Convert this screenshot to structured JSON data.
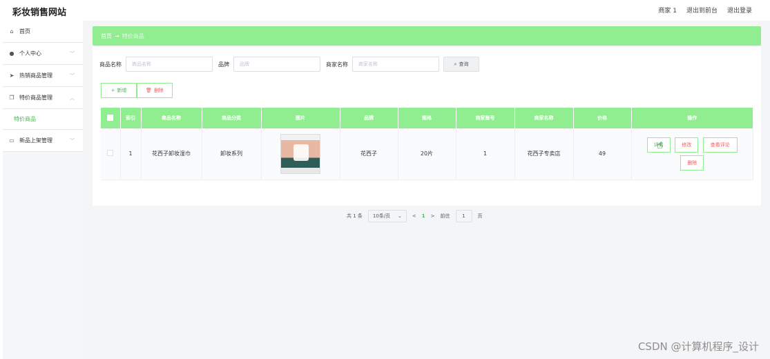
{
  "app": {
    "title": "彩妆销售网站"
  },
  "top_links": [
    "商家 1",
    "退出到前台",
    "退出登录"
  ],
  "sidebar": {
    "items": [
      {
        "label": "首页",
        "icon": "home-icon",
        "glyph": "⌂",
        "chevron": ""
      },
      {
        "label": "个人中心",
        "icon": "user-icon",
        "glyph": "●",
        "chevron": "﹀"
      },
      {
        "label": "热销商品管理",
        "icon": "send-icon",
        "glyph": "➤",
        "chevron": "﹀"
      },
      {
        "label": "特价商品管理",
        "icon": "copy-icon",
        "glyph": "❐",
        "chevron": "︿"
      },
      {
        "label": "新品上架管理",
        "icon": "box-icon",
        "glyph": "▭",
        "chevron": "﹀"
      }
    ],
    "sub_item": "特价商品"
  },
  "breadcrumb": {
    "home": "首页",
    "arrow": "→",
    "current": "特价商品"
  },
  "search": {
    "fields": [
      {
        "label": "商品名称",
        "placeholder": "商品名称"
      },
      {
        "label": "品牌",
        "placeholder": "品牌"
      },
      {
        "label": "商家名称",
        "placeholder": "商家名称"
      }
    ],
    "button_label": "查询"
  },
  "actions": {
    "add_label": "新增",
    "delete_label": "删除"
  },
  "table": {
    "headers": [
      "索引",
      "商品名称",
      "商品分类",
      "图片",
      "品牌",
      "规格",
      "商家账号",
      "商家名称",
      "价格",
      "操作"
    ],
    "rows": [
      {
        "index": "1",
        "name": "花西子卸妆湿巾",
        "category": "卸妆系列",
        "brand": "花西子",
        "spec": "20片",
        "account": "1",
        "merchant": "花西子专卖店",
        "price": "49"
      }
    ],
    "ops": {
      "detail": "详情",
      "edit": "修改",
      "review": "查看评论",
      "delete": "删除"
    }
  },
  "pager": {
    "total": "共 1 条",
    "page_size": "10条/页",
    "prev": "<",
    "current": "1",
    "next": ">",
    "goto": "前往",
    "goto_value": "1",
    "page_unit": "页"
  },
  "watermark": "CSDN @计算机程序_设计",
  "colors": {
    "accent_green": "#90ee90",
    "text_green": "#49b850",
    "danger": "#f25a5a"
  }
}
